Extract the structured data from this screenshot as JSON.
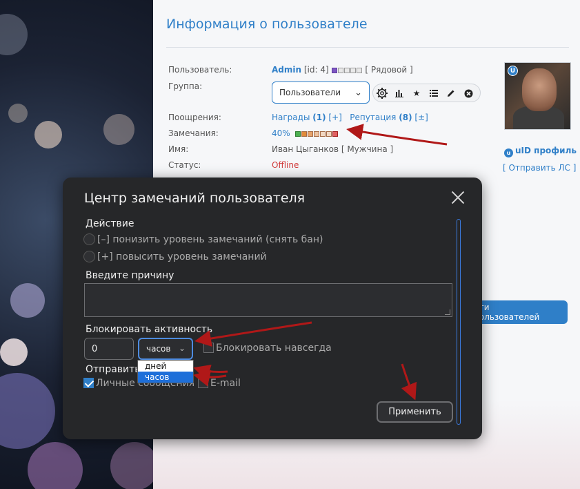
{
  "page": {
    "title": "Информация о пользователе"
  },
  "profile": {
    "user_label": "Пользователь:",
    "user_name": "Admin",
    "user_id": "[id: 4]",
    "user_rank": "[ Рядовой ]",
    "group_label": "Группа:",
    "group_value": "Пользователи",
    "rewards_label": "Поощрения:",
    "rewards_link": "Награды",
    "rewards_count": "(1)",
    "rewards_plus": "[+]",
    "reputation_link": "Репутация",
    "reputation_count": "(8)",
    "reputation_plusminus": "[±]",
    "warnings_label": "Замечания:",
    "warnings_percent": "40%",
    "name_label": "Имя:",
    "name_value": "Иван Цыганков [ Мужчина ]",
    "status_label": "Статус:",
    "status_value": "Offline",
    "uid_profile": "uID профиль",
    "send_pm": "[ Отправить ЛС ]",
    "find_users": "йти пользователей"
  },
  "colors": {
    "accent": "#2f7fc8",
    "status_offline": "#d13b3b",
    "modal_bg": "#262729",
    "arrow": "#b01818",
    "dropdown_selected": "#1e6fd9"
  },
  "modal": {
    "title": "Центр замечаний пользователя",
    "action_heading": "Действие",
    "option_decrease": "[–] понизить уровень замечаний (снять бан)",
    "option_increase": "[+] повысить уровень замечаний",
    "reason_heading": "Введите причину",
    "reason_value": "",
    "block_heading": "Блокировать активность",
    "block_amount": "0",
    "block_unit": "часов",
    "block_forever": "Блокировать навсегда",
    "notify_heading_visible_start": "Отправить",
    "notify_heading_visible_end": "е",
    "notify_pm": "Личные сообщения",
    "notify_email": "E-mail",
    "apply_button": "Применить",
    "unit_options": [
      "дней",
      "часов"
    ]
  }
}
